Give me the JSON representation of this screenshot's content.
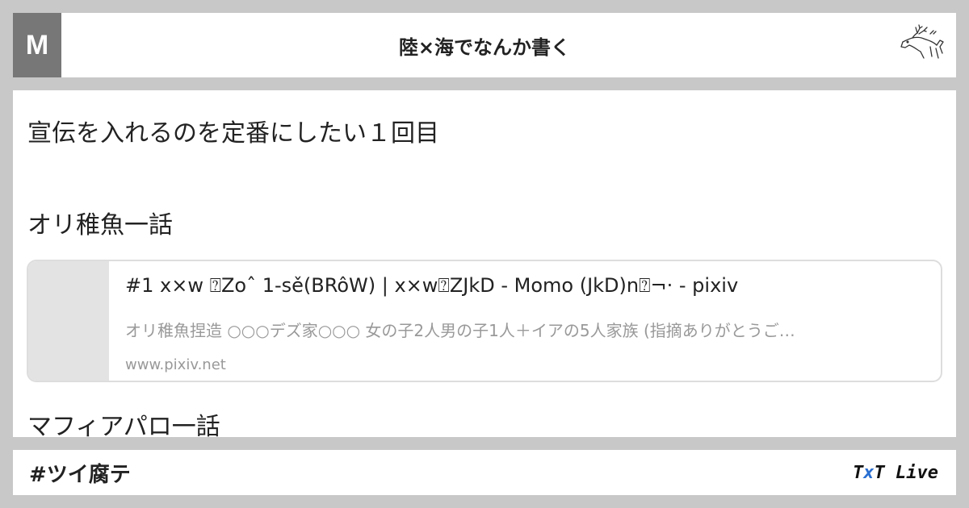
{
  "header": {
    "avatar_letter": "M",
    "title": "陸×海でなんか書く",
    "logo_icon": "deer-sketch-icon"
  },
  "content": {
    "heading1": "宣伝を入れるのを定番にしたい１回目",
    "heading2": "オリ稚魚一話",
    "card": {
      "title": "#1 x×w ⍰Zoˆ 1-sě(BRôW) | x×w⍰ZJkD - Momo (JkD)n⍰¬· - pixiv",
      "description": "オリ稚魚捏造 ○○○デズ家○○○ 女の子2人男の子1人＋イアの5人家族 (指摘ありがとうご…",
      "domain": "www.pixiv.net"
    },
    "heading3": "マフィアパロ一話"
  },
  "footer": {
    "hashtag": "#ツイ腐テ",
    "logo_t1": "T",
    "logo_x": "x",
    "logo_t2": "T Live"
  },
  "colors": {
    "background": "#c8c8c8",
    "avatar": "#777777",
    "logo_accent": "#2a6fd1"
  }
}
